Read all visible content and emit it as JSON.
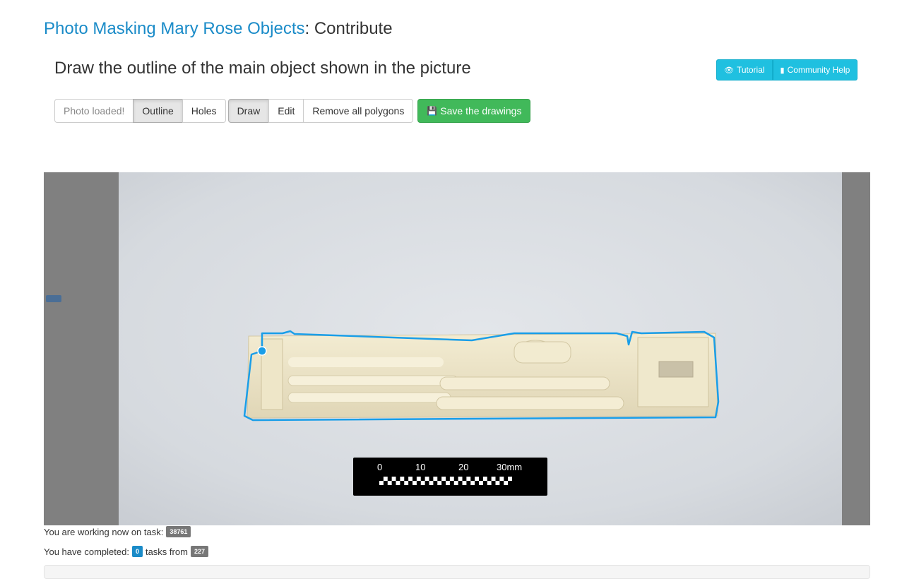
{
  "header": {
    "project_link": "Photo Masking Mary Rose Objects",
    "separator": ":",
    "subtitle": "Contribute"
  },
  "task": {
    "instruction": "Draw the outline of the main object shown in the picture"
  },
  "help": {
    "tutorial": "Tutorial",
    "tutorial_icon": "eye-icon",
    "community": "Community Help",
    "community_icon": "book-icon"
  },
  "toolbar": {
    "status": "Photo loaded!",
    "modes": [
      "Outline",
      "Holes"
    ],
    "active_mode": "Outline",
    "tools": [
      "Draw",
      "Edit",
      "Remove all polygons"
    ],
    "active_tool": "Draw",
    "save_label": "Save the drawings",
    "save_icon": "floppy-disk-icon"
  },
  "scale_bar": {
    "ticks": [
      "0",
      "10",
      "20",
      "30mm"
    ]
  },
  "progress": {
    "working_prefix": "You are working now on task:",
    "task_id": "38761",
    "completed_prefix": "You have completed:",
    "completed_count": "0",
    "tasks_from_label": "tasks from",
    "total_tasks": "227"
  },
  "colors": {
    "link": "#1a8bc8",
    "info_button": "#1fc0e0",
    "success_button": "#41b95a",
    "outline_stroke": "#1a9ee8",
    "canvas_bg": "#808080"
  }
}
